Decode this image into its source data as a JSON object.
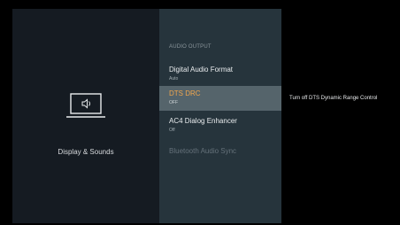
{
  "left_panel": {
    "icon": "tv-speaker-icon",
    "label": "Display & Sounds"
  },
  "menu": {
    "section_title": "AUDIO OUTPUT",
    "items": [
      {
        "title": "Digital Audio Format",
        "subtitle": "Auto",
        "state": "normal"
      },
      {
        "title": "DTS DRC",
        "subtitle": "OFF",
        "state": "selected"
      },
      {
        "title": "AC4 Dialog Enhancer",
        "subtitle": "Off",
        "state": "normal"
      },
      {
        "title": "Bluetooth Audio Sync",
        "subtitle": "",
        "state": "disabled"
      }
    ]
  },
  "description": {
    "text": "Turn off DTS Dynamic Range Control"
  },
  "colors": {
    "accent": "#f0a64e",
    "selected_bg": "#55646b",
    "menu_bg": "#26343c",
    "left_bg": "#151b22"
  }
}
